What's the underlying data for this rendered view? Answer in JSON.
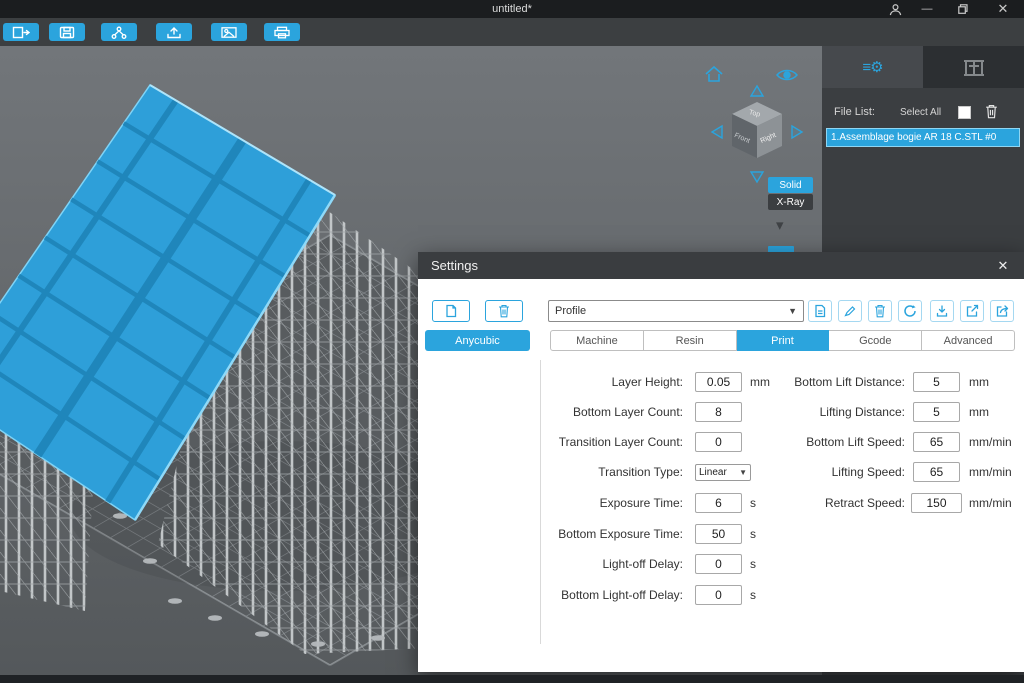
{
  "window": {
    "title": "untitled*"
  },
  "toolbar": {
    "icons": [
      "open-file",
      "save-file",
      "add-support",
      "slice-upload",
      "screenshot",
      "print"
    ]
  },
  "right_panel": {
    "tabs": [
      "settings-tab",
      "printer-tab"
    ],
    "file_list_label": "File List:",
    "select_all_label": "Select All",
    "files": [
      "1.Assemblage bogie AR 18 C.STL #0"
    ]
  },
  "viewport": {
    "solid_label": "Solid",
    "xray_label": "X-Ray",
    "cube": {
      "top": "Top",
      "front": "Front",
      "right": "Right"
    }
  },
  "settings": {
    "title": "Settings",
    "profile_value": "Profile",
    "brand_button_label": "Anycubic",
    "tabs": [
      "Machine",
      "Resin",
      "Print",
      "Gcode",
      "Advanced"
    ],
    "active_tab": "Print",
    "left_fields": [
      {
        "label": "Layer Height:",
        "value": "0.05",
        "unit": "mm"
      },
      {
        "label": "Bottom Layer Count:",
        "value": "8",
        "unit": ""
      },
      {
        "label": "Transition Layer Count:",
        "value": "0",
        "unit": ""
      },
      {
        "label": "Transition Type:",
        "value": "Linear",
        "unit": ""
      },
      {
        "label": "Exposure Time:",
        "value": "6",
        "unit": "s"
      },
      {
        "label": "Bottom Exposure Time:",
        "value": "50",
        "unit": "s"
      },
      {
        "label": "Light-off Delay:",
        "value": "0",
        "unit": "s"
      },
      {
        "label": "Bottom Light-off Delay:",
        "value": "0",
        "unit": "s"
      }
    ],
    "right_fields": [
      {
        "label": "Bottom Lift Distance:",
        "value": "5",
        "unit": "mm"
      },
      {
        "label": "Lifting Distance:",
        "value": "5",
        "unit": "mm"
      },
      {
        "label": "Bottom Lift Speed:",
        "value": "65",
        "unit": "mm/min"
      },
      {
        "label": "Lifting Speed:",
        "value": "65",
        "unit": "mm/min"
      },
      {
        "label": "Retract Speed:",
        "value": "150",
        "unit": "mm/min"
      }
    ]
  },
  "colors": {
    "accent": "#2ba4dd",
    "panel_dark": "#3b3e41",
    "viewport_gray": "#66696c"
  }
}
